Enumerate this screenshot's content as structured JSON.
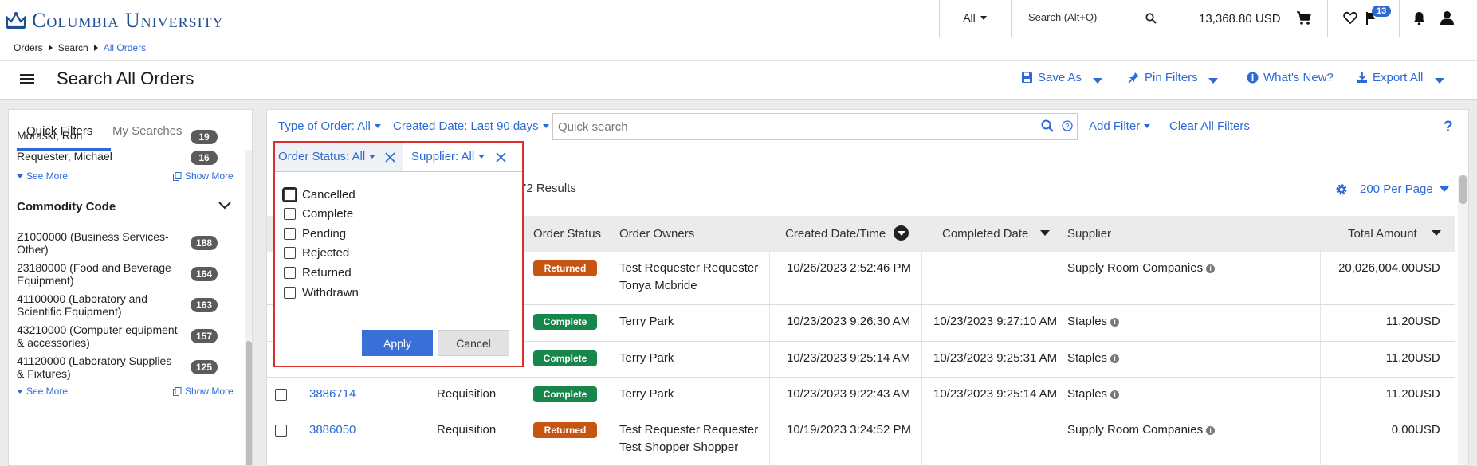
{
  "topbar": {
    "logo_text": "Columbia University",
    "scope_label": "All",
    "search_placeholder": "Search (Alt+Q)",
    "cart_amount": "13,368.80 USD",
    "notification_count": "13"
  },
  "breadcrumb": [
    "Orders",
    "Search",
    "All Orders"
  ],
  "header": {
    "title": "Search All Orders",
    "actions": {
      "save_as": "Save As",
      "pin_filters": "Pin Filters",
      "whats_new": "What's New?",
      "export_all": "Export All"
    }
  },
  "sidebar": {
    "tabs": [
      "Quick Filters",
      "My Searches"
    ],
    "requester_items": [
      {
        "label": "Moraski, Ron",
        "count": "19"
      },
      {
        "label": "Requester, Michael",
        "count": "16"
      }
    ],
    "see_more": "See More",
    "show_more": "Show More",
    "commodity_heading": "Commodity Code",
    "commodity_items": [
      {
        "line1": "Z1000000 (Business Services-",
        "line2": "Other)",
        "count": "188"
      },
      {
        "line1": "23180000 (Food and Beverage",
        "line2": "Equipment)",
        "count": "164"
      },
      {
        "line1": "41100000 (Laboratory and",
        "line2": "Scientific Equipment)",
        "count": "163"
      },
      {
        "line1": "43210000 (Computer equipment",
        "line2": "& accessories)",
        "count": "157"
      },
      {
        "line1": "41120000 (Laboratory Supplies",
        "line2": "& Fixtures)",
        "count": "125"
      }
    ]
  },
  "filters": {
    "type_of_order": "Type of Order: All",
    "created_date": "Created Date: Last 90 days",
    "quick_search_placeholder": "Quick search",
    "add_filter": "Add Filter",
    "clear_all": "Clear All Filters",
    "order_status": "Order Status: All",
    "supplier": "Supplier: All",
    "help": "?"
  },
  "status_popup": {
    "options": [
      "Cancelled",
      "Complete",
      "Pending",
      "Rejected",
      "Returned",
      "Withdrawn"
    ],
    "apply": "Apply",
    "cancel": "Cancel"
  },
  "results": {
    "count_text": "72 Results",
    "per_page": "200 Per Page"
  },
  "table": {
    "columns": [
      "Order Status",
      "Order Owners",
      "Created Date/Time",
      "Completed Date",
      "Supplier",
      "Total Amount"
    ],
    "rows": [
      {
        "order_no": "",
        "type": "",
        "status": "Returned",
        "owners_1": "Test Requester Requester",
        "owners_2": "Tonya Mcbride",
        "created": "10/26/2023 2:52:46 PM",
        "completed": "",
        "supplier": "Supply Room Companies",
        "amount": "20,026,004.00",
        "currency": "USD"
      },
      {
        "order_no": "",
        "type": "",
        "status": "Complete",
        "owners_1": "Terry Park",
        "owners_2": "",
        "created": "10/23/2023 9:26:30 AM",
        "completed": "10/23/2023 9:27:10 AM",
        "supplier": "Staples",
        "amount": "11.20",
        "currency": "USD"
      },
      {
        "order_no": "",
        "type": "",
        "status": "Complete",
        "owners_1": "Terry Park",
        "owners_2": "",
        "created": "10/23/2023 9:25:14 AM",
        "completed": "10/23/2023 9:25:31 AM",
        "supplier": "Staples",
        "amount": "11.20",
        "currency": "USD"
      },
      {
        "order_no": "3886714",
        "type": "Requisition",
        "status": "Complete",
        "owners_1": "Terry Park",
        "owners_2": "",
        "created": "10/23/2023 9:22:43 AM",
        "completed": "10/23/2023 9:25:14 AM",
        "supplier": "Staples",
        "amount": "11.20",
        "currency": "USD"
      },
      {
        "order_no": "3886050",
        "type": "Requisition",
        "status": "Returned",
        "owners_1": "Test Requester Requester",
        "owners_2": "Test Shopper Shopper",
        "created": "10/19/2023 3:24:52 PM",
        "completed": "",
        "supplier": "Supply Room Companies",
        "amount": "0.00",
        "currency": "USD"
      }
    ]
  },
  "colors": {
    "brand": "#1d4f91",
    "link": "#2d6ad6",
    "returned": "#c85411",
    "complete": "#17864a",
    "highlight": "#d9302c"
  }
}
